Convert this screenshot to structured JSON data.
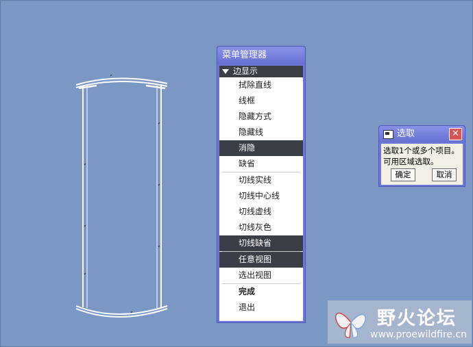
{
  "menu_manager": {
    "title": "菜单管理器",
    "header": "边显示",
    "items": [
      {
        "label": "拭除直线",
        "selected": false,
        "bold": false
      },
      {
        "label": "线框",
        "selected": false,
        "bold": false
      },
      {
        "label": "隐藏方式",
        "selected": false,
        "bold": false
      },
      {
        "label": "隐藏线",
        "selected": false,
        "bold": false
      },
      {
        "label": "消隐",
        "selected": true,
        "bold": false
      },
      {
        "label": "缺省",
        "selected": false,
        "bold": false
      },
      {
        "label": "切线实线",
        "selected": false,
        "bold": false
      },
      {
        "label": "切线中心线",
        "selected": false,
        "bold": false
      },
      {
        "label": "切线虚线",
        "selected": false,
        "bold": false
      },
      {
        "label": "切线灰色",
        "selected": false,
        "bold": false
      },
      {
        "label": "切线缺省",
        "selected": true,
        "bold": false
      },
      {
        "label": "任意视图",
        "selected": true,
        "bold": false
      },
      {
        "label": "选出视图",
        "selected": false,
        "bold": false
      },
      {
        "label": "完成",
        "selected": false,
        "bold": true
      },
      {
        "label": "退出",
        "selected": false,
        "bold": false
      }
    ]
  },
  "select_dialog": {
    "title": "选取",
    "line1": "选取1个或多个项目。",
    "line2": "可用区域选取。",
    "ok_label": "确定",
    "cancel_label": "取消"
  },
  "watermark": {
    "title": "野火论坛",
    "url": "www.proewildfire.cn"
  },
  "colors": {
    "background": "#7b98c4",
    "menu_frame": "#6f78d6",
    "selected_item": "#3a3f47"
  }
}
